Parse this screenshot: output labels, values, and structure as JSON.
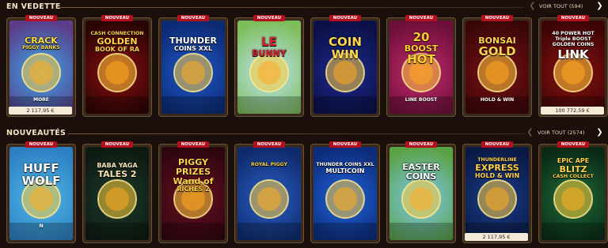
{
  "sections": [
    {
      "title": "EN VEDETTE",
      "see_all": "VOIR TOUT (594)",
      "games": [
        {
          "name_lines": [
            "CRACK",
            "PIGGY BANKS"
          ],
          "extra": "MORE",
          "badge": "NOUVEAU",
          "jackpot": "2 117,95 €",
          "bg1": "#3aa7e6",
          "bg2": "#5c3d8a",
          "logo_color": "#ffde3b"
        },
        {
          "name_lines": [
            "CASH CONNECTION",
            "GOLDEN",
            "BOOK OF RA"
          ],
          "badge": "NOUVEAU",
          "jackpot": "",
          "bg1": "#8a0d0d",
          "bg2": "#2a0505",
          "logo_color": "#ffd24a"
        },
        {
          "name_lines": [
            "THUNDER",
            "COINS XXL"
          ],
          "badge": "NOUVEAU",
          "jackpot": "",
          "bg1": "#1e57c9",
          "bg2": "#0c2a72",
          "logo_color": "#ffffff"
        },
        {
          "name_lines": [
            "LE",
            "BUNNY"
          ],
          "badge": "NOUVEAU",
          "jackpot": "",
          "bg1": "#bfe4f5",
          "bg2": "#7dbd5a",
          "logo_color": "#d81f2e"
        },
        {
          "name_lines": [
            "COIN",
            "WIN"
          ],
          "badge": "NOUVEAU",
          "jackpot": "",
          "bg1": "#1d2a8f",
          "bg2": "#0b1046",
          "logo_color": "#ffd74a"
        },
        {
          "name_lines": [
            "20",
            "BOOST",
            "HOT"
          ],
          "extra": "LINE BOOST",
          "badge": "NOUVEAU",
          "jackpot": "",
          "bg1": "#c22a6a",
          "bg2": "#6d0f3a",
          "logo_color": "#ffcf2e"
        },
        {
          "name_lines": [
            "BONSAI",
            "GOLD"
          ],
          "extra": "HOLD & WIN",
          "badge": "NOUVEAU",
          "jackpot": "",
          "bg1": "#7a0f14",
          "bg2": "#3a0708",
          "logo_color": "#ffd24a"
        },
        {
          "name_lines": [
            "40 POWER HOT",
            "Triple BOOST",
            "GOLDEN COINS",
            "LINK"
          ],
          "badge": "NOUVEAU",
          "jackpot": "100 772,59 €",
          "bg1": "#8c1212",
          "bg2": "#3d0505",
          "logo_color": "#ffffff"
        }
      ]
    },
    {
      "title": "NOUVEAUTÉS",
      "see_all": "VOIR TOUT (2574)",
      "games": [
        {
          "name_lines": [
            "HUFF",
            "WOLF"
          ],
          "extra": "N",
          "badge": "NOUVEAU",
          "jackpot": "",
          "bg1": "#4fb9e8",
          "bg2": "#2d7fc2",
          "logo_color": "#ffffff"
        },
        {
          "name_lines": [
            "BABA YAGA",
            "TALES 2"
          ],
          "badge": "NOUVEAU",
          "jackpot": "",
          "bg1": "#1f3a2a",
          "bg2": "#0c1a12",
          "logo_color": "#f5e3b5"
        },
        {
          "name_lines": [
            "PIGGY",
            "PRIZES",
            "Wand of",
            "RICHES 2"
          ],
          "badge": "NOUVEAU",
          "jackpot": "",
          "bg1": "#6b1020",
          "bg2": "#2d0610",
          "logo_color": "#ffd24a"
        },
        {
          "name_lines": [
            "ROYAL PIGGY"
          ],
          "badge": "NOUVEAU",
          "jackpot": "",
          "bg1": "#2a5ec4",
          "bg2": "#0f2a6b",
          "logo_color": "#ffd24a"
        },
        {
          "name_lines": [
            "THUNDER COINS XXL",
            "MULTICOIN"
          ],
          "badge": "NOUVEAU",
          "jackpot": "",
          "bg1": "#1f63d9",
          "bg2": "#0c2b7a",
          "logo_color": "#ffffff"
        },
        {
          "name_lines": [
            "EASTER",
            "COINS"
          ],
          "badge": "NOUVEAU",
          "jackpot": "",
          "bg1": "#7fc8ef",
          "bg2": "#5aa246",
          "logo_color": "#ffffff"
        },
        {
          "name_lines": [
            "THUNDERLINE",
            "EXPRESS",
            "HOLD & WIN"
          ],
          "badge": "NOUVEAU",
          "jackpot": "2 117,95 €",
          "bg1": "#1a3c8a",
          "bg2": "#0b1a45",
          "logo_color": "#ffd24a"
        },
        {
          "name_lines": [
            "EPIC APE",
            "BLITZ",
            "CASH COLLECT"
          ],
          "badge": "NOUVEAU",
          "jackpot": "",
          "bg1": "#1f6b3a",
          "bg2": "#0b2a16",
          "logo_color": "#ffd24a"
        }
      ]
    }
  ],
  "icons": {
    "prev": "chevron-left-icon",
    "next": "chevron-right-icon"
  },
  "colors": {
    "background": "#1a0f0a",
    "badge": "#b30f1d",
    "title": "#f2e2c4"
  }
}
